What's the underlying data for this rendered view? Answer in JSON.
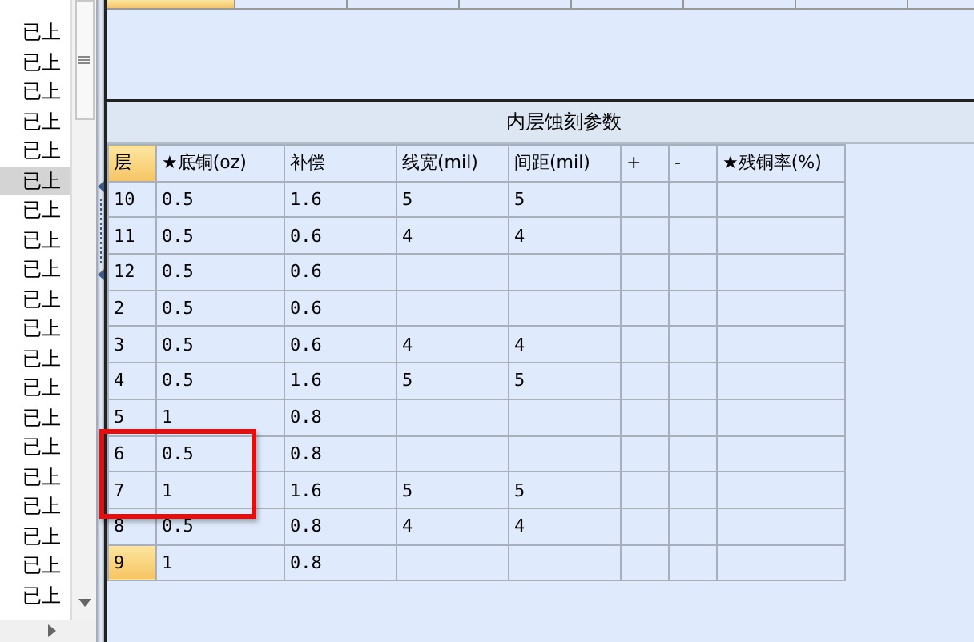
{
  "list": {
    "items": [
      {
        "label": "已上",
        "selected": false
      },
      {
        "label": "已上",
        "selected": false
      },
      {
        "label": "已上",
        "selected": false
      },
      {
        "label": "已上",
        "selected": false
      },
      {
        "label": "已上",
        "selected": false
      },
      {
        "label": "已上",
        "selected": true
      },
      {
        "label": "已上",
        "selected": false
      },
      {
        "label": "已上",
        "selected": false
      },
      {
        "label": "已上",
        "selected": false
      },
      {
        "label": "已上",
        "selected": false
      },
      {
        "label": "已上",
        "selected": false
      },
      {
        "label": "已上",
        "selected": false
      },
      {
        "label": "已上",
        "selected": false
      },
      {
        "label": "已上",
        "selected": false
      },
      {
        "label": "已上",
        "selected": false
      },
      {
        "label": "已上",
        "selected": false
      },
      {
        "label": "已上",
        "selected": false
      },
      {
        "label": "已上",
        "selected": false
      },
      {
        "label": "已上",
        "selected": false
      },
      {
        "label": "已上",
        "selected": false
      }
    ]
  },
  "table": {
    "title": "内层蚀刻参数",
    "columns": [
      "层",
      "★底铜(oz)",
      "补偿",
      "线宽(mil)",
      "间距(mil)",
      "+",
      "-",
      "★残铜率(%)"
    ],
    "rows": [
      {
        "cells": [
          "10",
          "0.5",
          "1.6",
          "5",
          "5",
          "",
          "",
          ""
        ],
        "selected": false
      },
      {
        "cells": [
          "11",
          "0.5",
          "0.6",
          "4",
          "4",
          "",
          "",
          ""
        ],
        "selected": false
      },
      {
        "cells": [
          "12",
          "0.5",
          "0.6",
          "",
          "",
          "",
          "",
          ""
        ],
        "selected": false
      },
      {
        "cells": [
          "2",
          "0.5",
          "0.6",
          "",
          "",
          "",
          "",
          ""
        ],
        "selected": false
      },
      {
        "cells": [
          "3",
          "0.5",
          "0.6",
          "4",
          "4",
          "",
          "",
          ""
        ],
        "selected": false
      },
      {
        "cells": [
          "4",
          "0.5",
          "1.6",
          "5",
          "5",
          "",
          "",
          ""
        ],
        "selected": false
      },
      {
        "cells": [
          "5",
          "1",
          "0.8",
          "",
          "",
          "",
          "",
          ""
        ],
        "selected": false
      },
      {
        "cells": [
          "6",
          "0.5",
          "0.8",
          "",
          "",
          "",
          "",
          ""
        ],
        "selected": false
      },
      {
        "cells": [
          "7",
          "1",
          "1.6",
          "5",
          "5",
          "",
          "",
          ""
        ],
        "selected": false
      },
      {
        "cells": [
          "8",
          "0.5",
          "0.8",
          "4",
          "4",
          "",
          "",
          ""
        ],
        "selected": false
      },
      {
        "cells": [
          "9",
          "1",
          "0.8",
          "",
          "",
          "",
          "",
          ""
        ],
        "selected": true
      }
    ]
  }
}
